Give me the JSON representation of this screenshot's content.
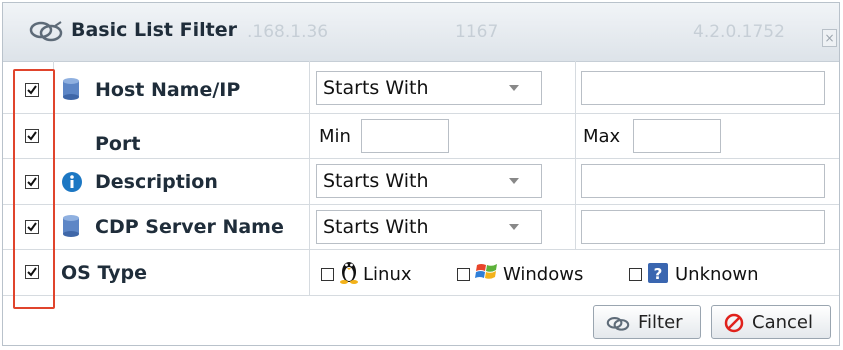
{
  "window": {
    "title": "Basic List Filter",
    "ghost_texts": [
      ".168.1.36",
      "1167",
      "4.2.0.1752"
    ],
    "close_label": "×"
  },
  "rows": [
    {
      "label": "Host Name/IP",
      "icon": "database-icon",
      "checked": true,
      "operator": "Starts With"
    },
    {
      "label": "Port",
      "icon": "",
      "checked": true,
      "min_label": "Min",
      "max_label": "Max"
    },
    {
      "label": "Description",
      "icon": "info-icon",
      "checked": true,
      "operator": "Starts With"
    },
    {
      "label": "CDP Server Name",
      "icon": "database-icon",
      "checked": true,
      "operator": "Starts With"
    },
    {
      "label": "OS Type",
      "icon": "",
      "checked": true,
      "options": [
        {
          "label": "Linux",
          "icon": "linux-icon",
          "checked": false
        },
        {
          "label": "Windows",
          "icon": "windows-icon",
          "checked": false
        },
        {
          "label": "Unknown",
          "icon": "unknown-icon",
          "checked": false
        }
      ]
    }
  ],
  "buttons": {
    "filter": "Filter",
    "cancel": "Cancel"
  },
  "colors": {
    "highlight": "#e0442c",
    "accent_blue": "#1c77c3"
  }
}
